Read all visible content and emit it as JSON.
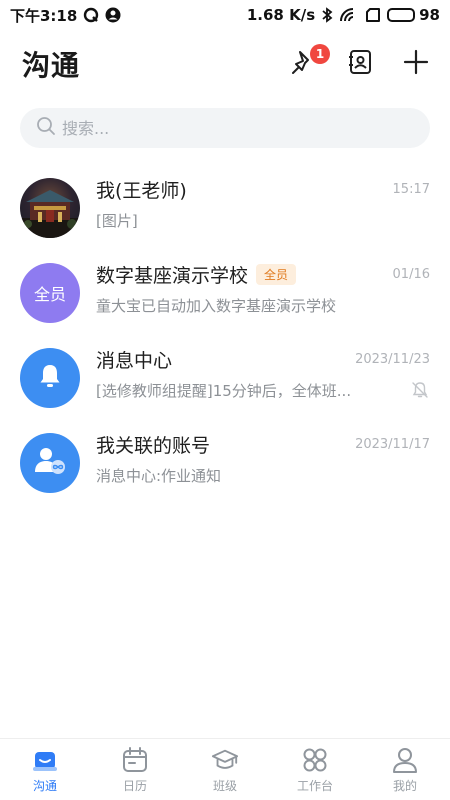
{
  "status_bar": {
    "time": "下午3:18",
    "net_speed": "1.68 K/s",
    "battery": "98",
    "battery_level": 0.98
  },
  "header": {
    "title": "沟通",
    "pin_badge": "1"
  },
  "search": {
    "placeholder": "搜索..."
  },
  "conversations": [
    {
      "name": "我(王老师)",
      "time": "15:17",
      "preview": "[图片]",
      "avatar": "photo"
    },
    {
      "name": "数字基座演示学校",
      "tag": "全员",
      "avatar_text": "全员",
      "time": "01/16",
      "preview": "童大宝已自动加入数字基座演示学校"
    },
    {
      "name": "消息中心",
      "time": "2023/11/23",
      "preview": "[选修教师组提醒]15分钟后，全体班...",
      "muted": true,
      "avatar": "bell-icon"
    },
    {
      "name": "我关联的账号",
      "time": "2023/11/17",
      "preview": "消息中心:作业通知",
      "avatar": "linked-account-icon"
    }
  ],
  "bottom_nav": {
    "items": [
      {
        "label": "沟通",
        "icon": "chat-icon",
        "active": true
      },
      {
        "label": "日历",
        "icon": "calendar-icon"
      },
      {
        "label": "班级",
        "icon": "graduation-cap-icon"
      },
      {
        "label": "工作台",
        "icon": "apps-grid-icon"
      },
      {
        "label": "我的",
        "icon": "profile-icon"
      }
    ]
  },
  "colors": {
    "accent": "#2f7cf6",
    "badge": "#f0473f",
    "tag_text": "#e07a1f",
    "tag_bg": "#fdeedd",
    "avatar_purple": "#8e7bf0",
    "avatar_blue": "#3d8ef2"
  }
}
